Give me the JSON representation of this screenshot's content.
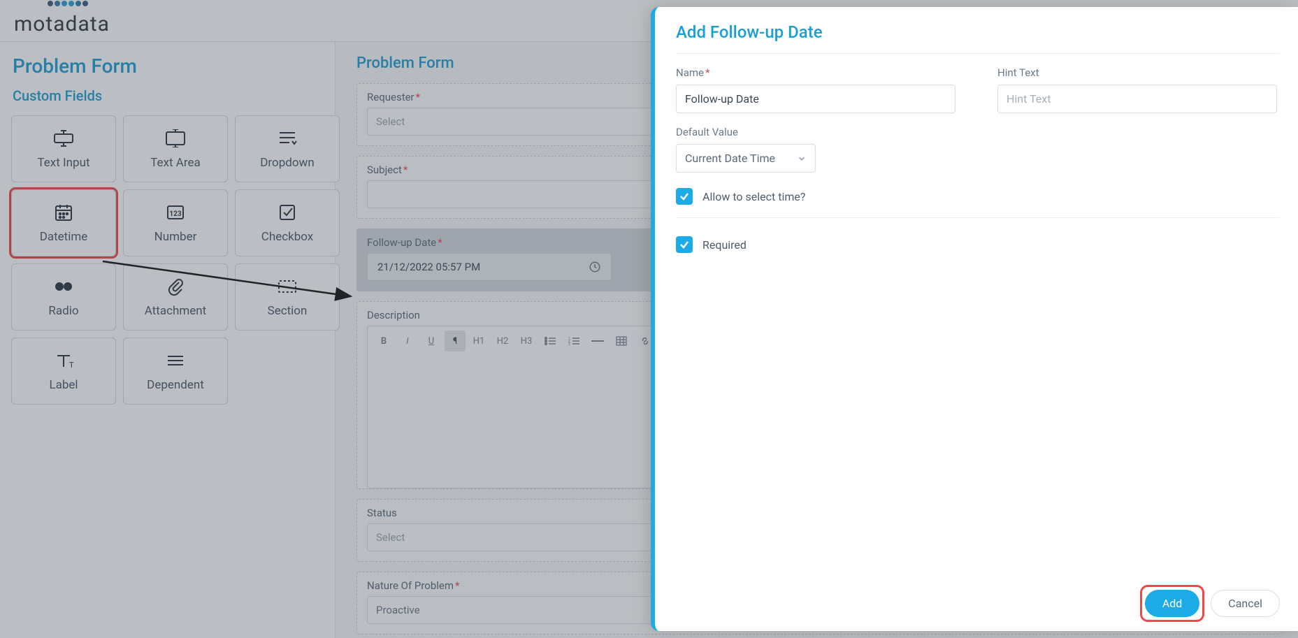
{
  "app": {
    "logo_text": "motadata"
  },
  "page": {
    "title": "Problem Form"
  },
  "custom_fields": {
    "heading": "Custom Fields",
    "tiles": [
      {
        "label": "Text Input"
      },
      {
        "label": "Text Area"
      },
      {
        "label": "Dropdown"
      },
      {
        "label": "Datetime"
      },
      {
        "label": "Number"
      },
      {
        "label": "Checkbox"
      },
      {
        "label": "Radio"
      },
      {
        "label": "Attachment"
      },
      {
        "label": "Section"
      },
      {
        "label": "Label"
      },
      {
        "label": "Dependent"
      }
    ]
  },
  "form": {
    "heading": "Problem Form",
    "requester": {
      "label": "Requester",
      "placeholder": "Select"
    },
    "subject": {
      "label": "Subject"
    },
    "followup": {
      "label": "Follow-up Date",
      "value": "21/12/2022 05:57 PM"
    },
    "description": {
      "label": "Description"
    },
    "rte": {
      "h1": "H1",
      "h2": "H2",
      "h3": "H3"
    },
    "status": {
      "label": "Status",
      "placeholder": "Select"
    },
    "nature": {
      "label": "Nature Of Problem",
      "value": "Proactive"
    }
  },
  "drawer": {
    "title": "Add Follow-up Date",
    "name_label": "Name",
    "name_value": "Follow-up Date",
    "hint_label": "Hint Text",
    "hint_placeholder": "Hint Text",
    "default_label": "Default Value",
    "default_value": "Current Date  Time",
    "allow_time_label": "Allow to select time?",
    "required_label": "Required",
    "add_btn": "Add",
    "cancel_btn": "Cancel"
  },
  "colors": {
    "accent": "#1cabe6",
    "highlight": "#f04848"
  }
}
